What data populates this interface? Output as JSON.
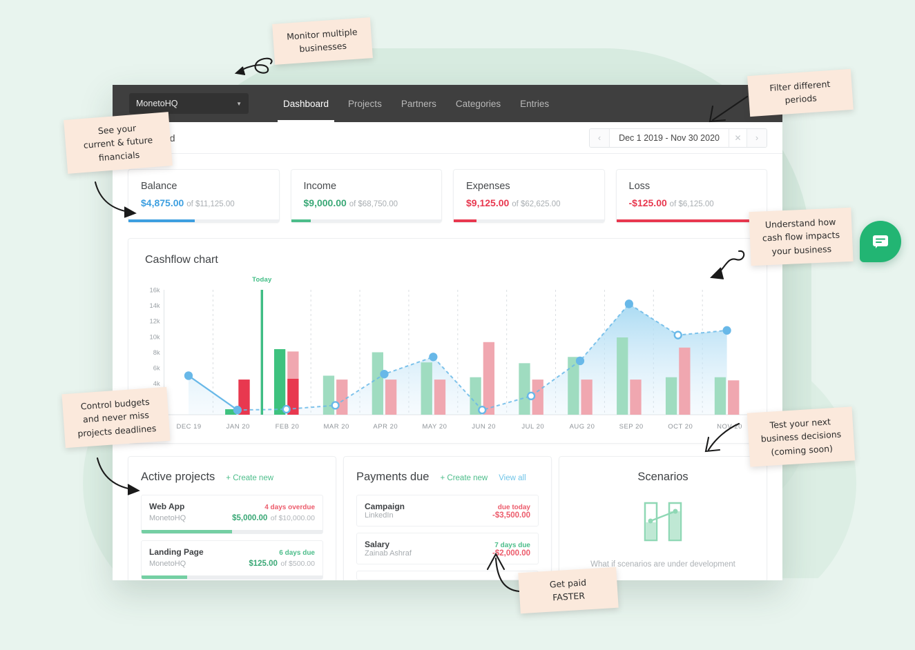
{
  "nav": {
    "org": "MonetoHQ",
    "caret_icon": "chevron-down-icon",
    "links": [
      {
        "label": "Dashboard",
        "active": true
      },
      {
        "label": "Projects",
        "active": false
      },
      {
        "label": "Partners",
        "active": false
      },
      {
        "label": "Categories",
        "active": false
      },
      {
        "label": "Entries",
        "active": false
      }
    ]
  },
  "pagehead": {
    "title": "Dashboard",
    "date_range": "Dec 1 2019 - Nov 30 2020",
    "prev_icon": "chevron-left-icon",
    "next_icon": "chevron-right-icon",
    "clear_icon": "close-icon"
  },
  "kpis": [
    {
      "label": "Balance",
      "amount": "$4,875.00",
      "of": "of $11,125.00",
      "color": "#3d9fe0",
      "pct": 44
    },
    {
      "label": "Income",
      "amount": "$9,000.00",
      "of": "of $68,750.00",
      "color": "#4cbd8a",
      "pct": 13
    },
    {
      "label": "Expenses",
      "amount": "$9,125.00",
      "of": "of $62,625.00",
      "color": "#e8384f",
      "pct": 15
    },
    {
      "label": "Loss",
      "amount": "-$125.00",
      "of": "of $6,125.00",
      "color": "#e8384f",
      "pct": 100
    }
  ],
  "chart": {
    "title": "Cashflow chart",
    "today_label": "Today"
  },
  "chart_data": {
    "type": "bar",
    "title": "Cashflow chart",
    "xlabel": "",
    "ylabel": "",
    "ylim": [
      0,
      16000
    ],
    "grid": true,
    "legend_position": "none",
    "yticks": [
      "4k",
      "6k",
      "8k",
      "10k",
      "12k",
      "14k",
      "16k"
    ],
    "ytick_values": [
      4000,
      6000,
      8000,
      10000,
      12000,
      14000,
      16000
    ],
    "categories": [
      "DEC 19",
      "JAN 20",
      "FEB 20",
      "MAR 20",
      "APR 20",
      "MAY 20",
      "JUN 20",
      "JUL 20",
      "AUG 20",
      "SEP 20",
      "OCT 20",
      "NOV 20"
    ],
    "annotations": [
      {
        "text": "Today",
        "x": "between JAN 20 and FEB 20",
        "value": 16000,
        "color": "#3fbd84"
      }
    ],
    "series": [
      {
        "name": "Income",
        "type": "bar",
        "color": "#3ec27f",
        "faded_color": "#9fdcc0",
        "values": [
          0,
          700,
          8400,
          5000,
          8000,
          6700,
          4800,
          6600,
          7400,
          9900,
          4800,
          4800
        ],
        "actual_through_index": 2
      },
      {
        "name": "Expenses",
        "type": "bar",
        "color": "#e8384f",
        "faded_color": "#f0a7b0",
        "values": [
          0,
          4500,
          8100,
          4500,
          4500,
          4500,
          9300,
          4500,
          4500,
          4500,
          8600,
          4400
        ],
        "actual_through_index": 2
      },
      {
        "name": "Balance",
        "type": "line-area",
        "color": "#68b8e8",
        "fill": "#cbe7f7",
        "values": [
          5000,
          600,
          700,
          1200,
          5200,
          7400,
          600,
          2400,
          6900,
          14200,
          10200,
          10800
        ],
        "actual_through_index": 1
      }
    ]
  },
  "active_projects": {
    "title": "Active projects",
    "create_label": "+ Create new",
    "items": [
      {
        "name": "Web App",
        "sub": "MonetoHQ",
        "due": "4 days overdue",
        "due_state": "overdue",
        "amount": "$5,000.00",
        "of": "of $10,000.00",
        "pct": 50
      },
      {
        "name": "Landing Page",
        "sub": "MonetoHQ",
        "due": "6 days due",
        "due_state": "due",
        "amount": "$125.00",
        "of": "of $500.00",
        "pct": 25
      }
    ]
  },
  "payments_due": {
    "title": "Payments due",
    "create_label": "+ Create new",
    "viewall_label": "View all",
    "items": [
      {
        "name": "Campaign",
        "sub": "LinkedIn",
        "due": "due today",
        "due_state": "overdue",
        "amount": "-$3,500.00"
      },
      {
        "name": "Salary",
        "sub": "Zainab Ashraf",
        "due": "7 days due",
        "due_state": "due",
        "amount": "-$2,000.00"
      }
    ]
  },
  "scenarios": {
    "title": "Scenarios",
    "icon": "bar-chart-placeholder-icon",
    "note": "What if scenarios are under development"
  },
  "notes": [
    {
      "id": "note-monitor",
      "text": "Monitor multiple\nbusinesses"
    },
    {
      "id": "note-financials",
      "text": "See your\ncurrent & future\nfinancials"
    },
    {
      "id": "note-filter",
      "text": "Filter different\nperiods"
    },
    {
      "id": "note-cashflow",
      "text": "Understand how\ncash flow impacts\nyour business"
    },
    {
      "id": "note-budgets",
      "text": "Control budgets\nand never miss\nprojects deadlines"
    },
    {
      "id": "note-scenarios",
      "text": "Test your next\nbusiness decisions\n(coming soon)"
    },
    {
      "id": "note-getpaid",
      "text": "Get paid\nFASTER"
    }
  ],
  "chat": {
    "icon": "chat-bubble-icon",
    "color": "#22b573"
  }
}
